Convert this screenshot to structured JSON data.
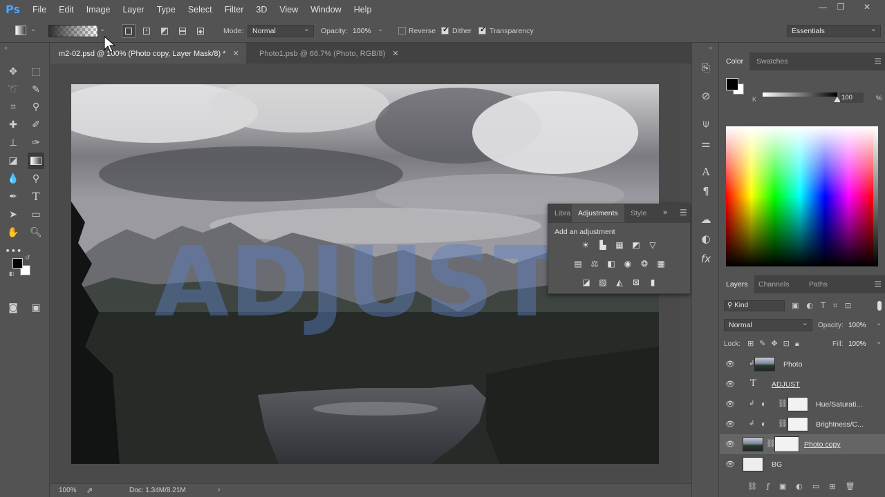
{
  "app": {
    "logo": "Ps"
  },
  "menubar": {
    "items": [
      "File",
      "Edit",
      "Image",
      "Layer",
      "Type",
      "Select",
      "Filter",
      "3D",
      "View",
      "Window",
      "Help"
    ]
  },
  "options": {
    "mode_label": "Mode:",
    "mode_value": "Normal",
    "opacity_label": "Opacity:",
    "opacity_value": "100%",
    "reverse_label": "Reverse",
    "reverse_checked": false,
    "dither_label": "Dither",
    "dither_checked": true,
    "transparency_label": "Transparency",
    "transparency_checked": true,
    "workspace_value": "Essentials"
  },
  "tabs": [
    {
      "label": "m2-02.psd @ 100% (Photo copy, Layer Mask/8) *",
      "active": true
    },
    {
      "label": "Photo1.psb @ 66.7% (Photo, RGB/8)",
      "active": false
    }
  ],
  "canvas": {
    "overlay_text": "ADJUST"
  },
  "status": {
    "zoom": "100%",
    "doc": "Doc: 1.34M/8.21M"
  },
  "color_panel": {
    "tabs": [
      "Color",
      "Swatches"
    ],
    "channel_label": "K",
    "value": "100",
    "unit": "%",
    "k_fraction": 1.0
  },
  "adjustments": {
    "tabs": [
      "Libra",
      "Adjustments",
      "Style"
    ],
    "title": "Add an adjustment"
  },
  "layers_panel": {
    "tabs": [
      "Layers",
      "Channels",
      "Paths"
    ],
    "filter_label": "Kind",
    "blend_mode": "Normal",
    "opacity_label": "Opacity:",
    "opacity_value": "100%",
    "lock_label": "Lock:",
    "fill_label": "Fill:",
    "fill_value": "100%",
    "layers": [
      {
        "name": "Photo",
        "kind": "smart"
      },
      {
        "name": "ADJUST",
        "kind": "text"
      },
      {
        "name": "Hue/Saturati...",
        "kind": "adjustment"
      },
      {
        "name": "Brightness/C...",
        "kind": "adjustment"
      },
      {
        "name": "Photo copy",
        "kind": "masked",
        "selected": true
      },
      {
        "name": "BG",
        "kind": "fill"
      }
    ]
  },
  "colors": {
    "accent_blue": "#4fa3ff",
    "overlay_text": "#5b7fc4",
    "selected_row": "#656565"
  }
}
